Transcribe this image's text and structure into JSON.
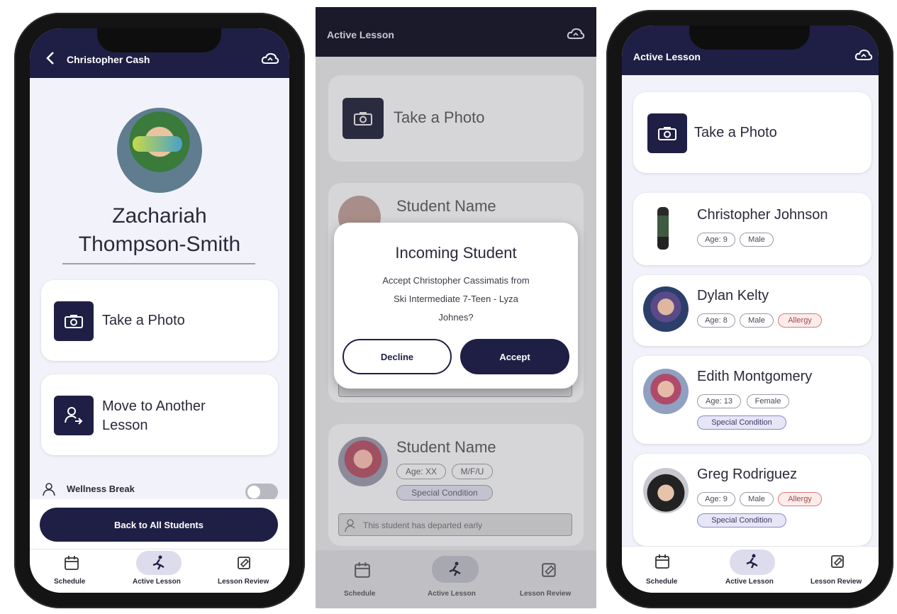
{
  "left_phone": {
    "header_title": "Christopher Cash",
    "student_name_line1": "Zachariah",
    "student_name_line2": "Thompson-Smith",
    "take_photo_label": "Take a Photo",
    "move_label_line1": "Move to Another",
    "move_label_line2": "Lesson",
    "wellness_label": "Wellness Break",
    "back_button_label": "Back to All Students",
    "nav": {
      "schedule": "Schedule",
      "active": "Active Lesson",
      "review": "Lesson Review"
    }
  },
  "middle_phone": {
    "header_title": "Active Lesson",
    "take_photo_label": "Take a Photo",
    "student_card_1": {
      "name": "Student Name"
    },
    "student_card_2": {
      "name": "Student Name",
      "tag_age": "Age: XX",
      "tag_gender": "M/F/U",
      "tag_special": "Special Condition",
      "departed_text": "This student has departed early"
    },
    "modal": {
      "title": "Incoming Student",
      "message_line1": "Accept Christopher Cassimatis from",
      "message_line2": "Ski Intermediate 7-Teen - Lyza",
      "message_line3": "Johnes?",
      "decline": "Decline",
      "accept": "Accept"
    },
    "nav": {
      "schedule": "Schedule",
      "active": "Active Lesson",
      "review": "Lesson Review"
    }
  },
  "right_phone": {
    "header_title": "Active Lesson",
    "take_photo_label": "Take a Photo",
    "students": [
      {
        "name": "Christopher Johnson",
        "age": "Age: 9",
        "gender": "Male"
      },
      {
        "name": "Dylan Kelty",
        "age": "Age: 8",
        "gender": "Male",
        "allergy": "Allergy"
      },
      {
        "name": "Edith Montgomery",
        "age": "Age: 13",
        "gender": "Female",
        "special": "Special Condition"
      },
      {
        "name": "Greg Rodriguez",
        "age": "Age: 9",
        "gender": "Male",
        "allergy": "Allergy",
        "special": "Special Condition"
      }
    ],
    "nav": {
      "schedule": "Schedule",
      "active": "Active Lesson",
      "review": "Lesson Review"
    }
  },
  "colors": {
    "navy": "#1f1f45",
    "accent_allergy": "#d77a7a",
    "accent_special": "#8a8ac0"
  }
}
